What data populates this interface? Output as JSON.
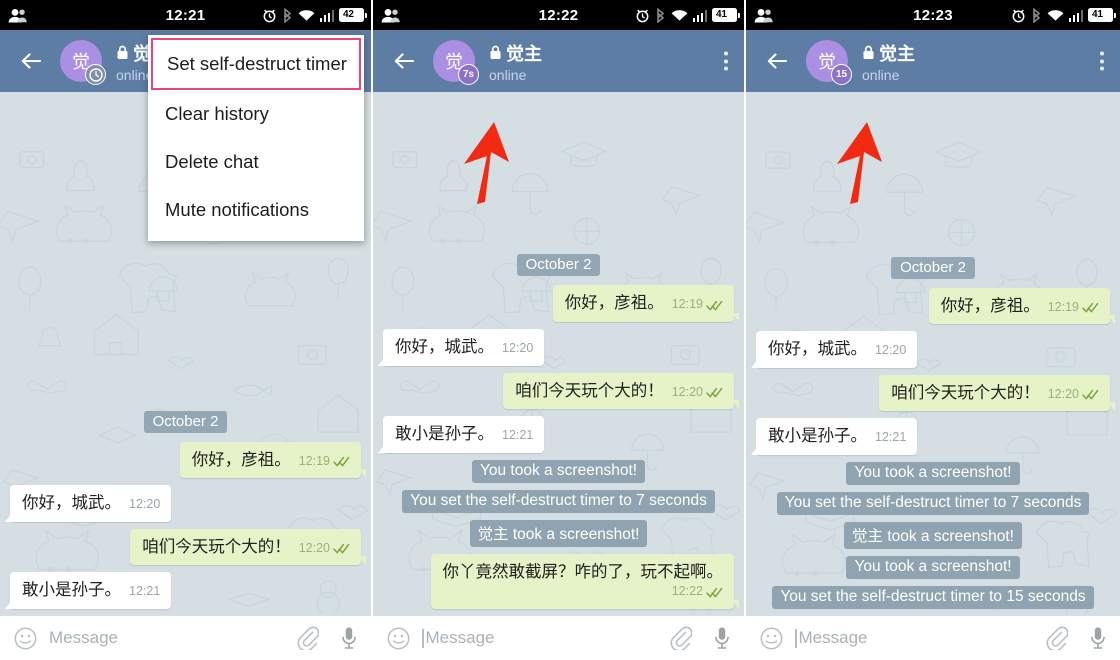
{
  "app": "Telegram chat — self-destruct timer",
  "colors": {
    "header": "#5e7da4",
    "chat_background": "#d5dee3",
    "out_bubble": "#e6f3c8",
    "in_bubble": "#ffffff",
    "service_chip": "#8fa3b0",
    "avatar": "#ab8fe3",
    "highlight_border": "#e8447f",
    "arrow": "#f22a11"
  },
  "icons": {
    "contacts": "contacts-icon",
    "alarm": "alarm-clock-icon",
    "bluetooth": "bluetooth-icon",
    "wifi": "wifi-icon",
    "signal": "signal-bars-icon",
    "battery": "battery-icon",
    "back": "back-arrow-icon",
    "lock": "lock-icon",
    "menu": "overflow-menu-icon",
    "emoji": "smiley-icon",
    "attach": "paperclip-icon",
    "voice": "microphone-icon",
    "ticks": "double-check-icon",
    "clock": "clock-icon"
  },
  "panels": [
    {
      "status": {
        "time": "12:21",
        "battery": "42"
      },
      "header": {
        "name": "觉主",
        "status_text": "online",
        "avatar_letter": "觉",
        "timer_badge": "",
        "timer_badge_kind": "clock"
      },
      "menu": {
        "items": [
          {
            "label": "Set self-destruct timer",
            "highlighted": true
          },
          {
            "label": "Clear history",
            "highlighted": false
          },
          {
            "label": "Delete chat",
            "highlighted": false
          },
          {
            "label": "Mute notifications",
            "highlighted": false
          }
        ]
      },
      "day_separator": "October 2",
      "messages": [
        {
          "kind": "out",
          "text": "你好，彦祖。",
          "time": "12:19",
          "ticks": true
        },
        {
          "kind": "in",
          "text": "你好，城武。",
          "time": "12:20",
          "ticks": false
        },
        {
          "kind": "out",
          "text": "咱们今天玩个大的！",
          "time": "12:20",
          "ticks": true
        },
        {
          "kind": "in",
          "text": "敢小是孙子。",
          "time": "12:21",
          "ticks": false
        }
      ],
      "composer": {
        "placeholder": "Message",
        "caret": false
      },
      "arrow": false
    },
    {
      "status": {
        "time": "12:22",
        "battery": "41"
      },
      "header": {
        "name": "觉主",
        "status_text": "online",
        "avatar_letter": "觉",
        "timer_badge": "7s",
        "timer_badge_kind": "text"
      },
      "menu": {
        "items": []
      },
      "day_separator": "October 2",
      "messages": [
        {
          "kind": "out",
          "text": "你好，彦祖。",
          "time": "12:19",
          "ticks": true
        },
        {
          "kind": "in",
          "text": "你好，城武。",
          "time": "12:20",
          "ticks": false
        },
        {
          "kind": "out",
          "text": "咱们今天玩个大的！",
          "time": "12:20",
          "ticks": true
        },
        {
          "kind": "in",
          "text": "敢小是孙子。",
          "time": "12:21",
          "ticks": false
        },
        {
          "kind": "service",
          "text": "You took a screenshot!"
        },
        {
          "kind": "service",
          "text": "You set the self-destruct timer to 7 seconds"
        },
        {
          "kind": "service",
          "text": "觉主 took a screenshot!"
        },
        {
          "kind": "out-stacked",
          "text": "你丫竟然敢截屏？咋的了，玩不起啊。",
          "time": "12:22",
          "ticks": true
        }
      ],
      "composer": {
        "placeholder": "Message",
        "caret": true
      },
      "arrow": true
    },
    {
      "status": {
        "time": "12:23",
        "battery": "41"
      },
      "header": {
        "name": "觉主",
        "status_text": "online",
        "avatar_letter": "觉",
        "timer_badge": "15",
        "timer_badge_kind": "text"
      },
      "menu": {
        "items": []
      },
      "day_separator": "October 2",
      "messages": [
        {
          "kind": "out",
          "text": "你好，彦祖。",
          "time": "12:19",
          "ticks": true
        },
        {
          "kind": "in",
          "text": "你好，城武。",
          "time": "12:20",
          "ticks": false
        },
        {
          "kind": "out",
          "text": "咱们今天玩个大的！",
          "time": "12:20",
          "ticks": true
        },
        {
          "kind": "in",
          "text": "敢小是孙子。",
          "time": "12:21",
          "ticks": false
        },
        {
          "kind": "service",
          "text": "You took a screenshot!"
        },
        {
          "kind": "service",
          "text": "You set the self-destruct timer to 7 seconds"
        },
        {
          "kind": "service",
          "text": "觉主 took a screenshot!"
        },
        {
          "kind": "service",
          "text": "You took a screenshot!"
        },
        {
          "kind": "service",
          "text": "You set the self-destruct timer to 15 seconds"
        }
      ],
      "composer": {
        "placeholder": "Message",
        "caret": true
      },
      "arrow": true
    }
  ]
}
